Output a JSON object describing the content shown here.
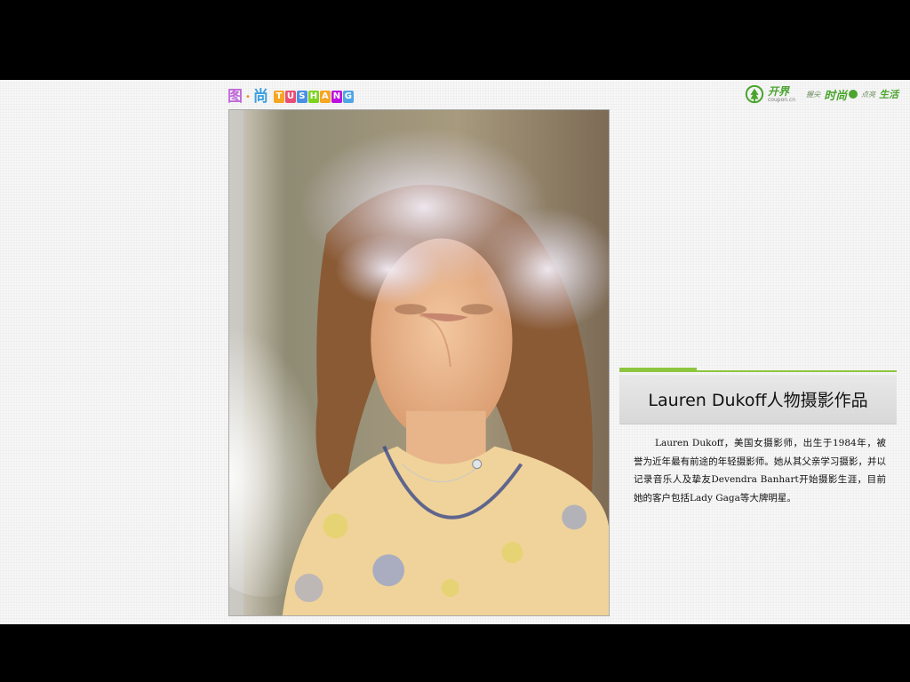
{
  "header_logo": {
    "cn_char_1": "图",
    "cn_char_2": "尚",
    "letters": [
      "T",
      "U",
      "S",
      "H",
      "A",
      "N",
      "G"
    ],
    "letter_colors": [
      "#f5a623",
      "#e94e77",
      "#4a90e2",
      "#7ed321",
      "#f5a623",
      "#bd10e0",
      "#50a5e6"
    ]
  },
  "partner_logo": {
    "brand": "开界",
    "brand_sub": "coupon.cn",
    "slogan_1": "握尖",
    "slogan_2": "时尚",
    "slogan_3": "点亮",
    "slogan_4": "生活",
    "accent_color": "#4aa52e"
  },
  "article": {
    "title": "Lauren Dukoff人物摄影作品",
    "description": "Lauren Dukoff，美国女摄影师，出生于1984年，被誉为近年最有前途的年轻摄影师。她从其父亲学习摄影，并以记录音乐人及挚友Devendra  Banhart开始摄影生涯，目前她的客户包括Lady Gaga等大牌明星。"
  },
  "colors": {
    "accent_green": "#8cc63f",
    "letterbox": "#000000",
    "slide_bg": "#f7f7f7"
  }
}
